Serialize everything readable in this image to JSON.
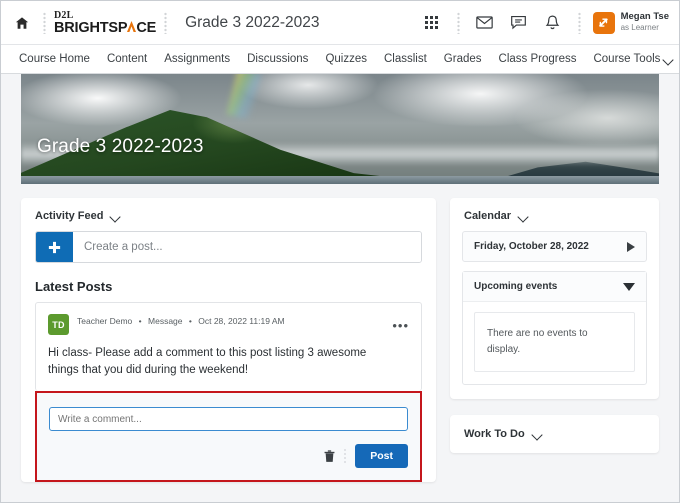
{
  "header": {
    "home_icon": "home-icon",
    "logo_d2l": "D2L",
    "logo_brightspace_pre": "BRIGHTSP",
    "logo_brightspace_post": "CE",
    "course_title": "Grade 3 2022-2023",
    "icons": {
      "waffle": "app-grid-icon",
      "mail": "envelope-icon",
      "chat": "chat-bubble-icon",
      "bell": "notification-bell-icon",
      "swap": "role-switch-icon"
    },
    "user_name": "Megan Tse",
    "user_role": "as Learner"
  },
  "nav": {
    "items": [
      {
        "label": "Course Home",
        "has_caret": false
      },
      {
        "label": "Content",
        "has_caret": false
      },
      {
        "label": "Assignments",
        "has_caret": false
      },
      {
        "label": "Discussions",
        "has_caret": false
      },
      {
        "label": "Quizzes",
        "has_caret": false
      },
      {
        "label": "Classlist",
        "has_caret": false
      },
      {
        "label": "Grades",
        "has_caret": false
      },
      {
        "label": "Class Progress",
        "has_caret": false
      },
      {
        "label": "Course Tools",
        "has_caret": true
      }
    ]
  },
  "banner": {
    "title": "Grade 3 2022-2023",
    "description": "mountain-landscape-with-clouds-and-rainbow"
  },
  "activity_feed": {
    "widget_title": "Activity Feed",
    "create_post_placeholder": "Create a post...",
    "create_post_icon": "plus-icon",
    "latest_posts_heading": "Latest Posts",
    "post": {
      "avatar_initials": "TD",
      "author": "Teacher Demo",
      "type": "Message",
      "timestamp": "Oct 28, 2022 11:19 AM",
      "separator": "•",
      "body": "Hi class- Please add a comment to this post listing 3 awesome things that you did during the weekend!",
      "more_menu_icon": "ellipsis-icon"
    },
    "comment": {
      "placeholder": "Write a comment...",
      "value": "",
      "delete_icon": "trash-icon",
      "post_label": "Post"
    }
  },
  "calendar": {
    "widget_title": "Calendar",
    "current_date": "Friday, October 28, 2022",
    "next_icon": "play-arrow-right-icon",
    "upcoming_title": "Upcoming events",
    "collapse_icon": "triangle-down-icon",
    "empty_message": "There are no events to display."
  },
  "work_to_do": {
    "widget_title": "Work To Do"
  },
  "colors": {
    "brand_orange": "#e8740c",
    "primary_blue": "#0f6cb5",
    "post_button_blue": "#1569b8",
    "avatar_green": "#5c9a2e",
    "highlight_red": "#c4161c",
    "page_bg": "#f4f5f7"
  }
}
